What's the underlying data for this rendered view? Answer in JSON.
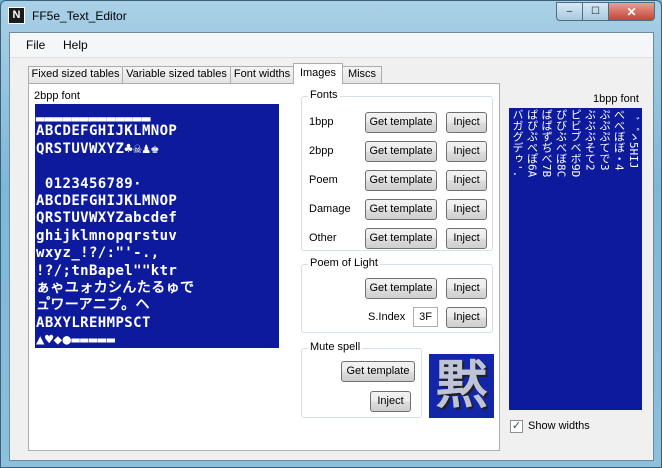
{
  "window": {
    "title": "FF5e_Text_Editor",
    "icon": "app-logo-icon"
  },
  "controls": {
    "minimize": "–",
    "maximize": "☐",
    "close": "✕"
  },
  "menu": {
    "file": "File",
    "help": "Help"
  },
  "tabs": [
    "Fixed sized tables",
    "Variable sized tables",
    "Font widths",
    "Images",
    "Miscs"
  ],
  "left_canvas": {
    "label": "2bpp font",
    "rows": [
      "▂▂▂▂▂▂▂▂▂▂▂▂▂",
      "ABCDEFGHIJKLMNOP",
      "QRSTUVWXYZ♣☠♟♚",
      "",
      " 0123456789·",
      "ABCDEFGHIJKLMNOP",
      "QRSTUVWXYZabcdef",
      "ghijklmnopqrstuv",
      "wxyz_!?/:\"'-.,",
      "!?/;tnBapel\"\"ktr",
      "ぁゃユォカシんたるゅで",
      "ュ゚ワーアニプ。ヘ",
      "ABXYLREHMPSCT",
      "▲♥◆●▬▬▬▬▬"
    ]
  },
  "fonts_group": {
    "title": "Fonts",
    "rows": [
      {
        "label": "1bpp",
        "template": "Get template",
        "inject": "Inject"
      },
      {
        "label": "2bpp",
        "template": "Get template",
        "inject": "Inject"
      },
      {
        "label": "Poem",
        "template": "Get template",
        "inject": "Inject"
      },
      {
        "label": "Damage",
        "template": "Get template",
        "inject": "Inject"
      },
      {
        "label": "Other",
        "template": "Get template",
        "inject": "Inject"
      }
    ]
  },
  "poem_group": {
    "title": "Poem of Light",
    "template": "Get template",
    "inject": "Inject",
    "sindex_label": "S.Index",
    "sindex_value": "3F",
    "inject2": "Inject"
  },
  "mute_group": {
    "title": "Mute spell",
    "template": "Get template",
    "inject": "Inject",
    "glyph": "黙"
  },
  "right_canvas": {
    "label": "1bpp font",
    "columns": [
      "バガグデゥ'.",
      "ぱぴぷぺぽ6A",
      "ぱぱずぢべ7B",
      "ぴびぶべぼ8C",
      "ピビブベボ9D",
      "ぶぶぶそて2",
      "ぷぷぷてで3",
      "べべぼぼ・4",
      "゛゜ゝ5HIJ"
    ],
    "show_widths_label": "Show widths",
    "show_widths_checked": true
  }
}
